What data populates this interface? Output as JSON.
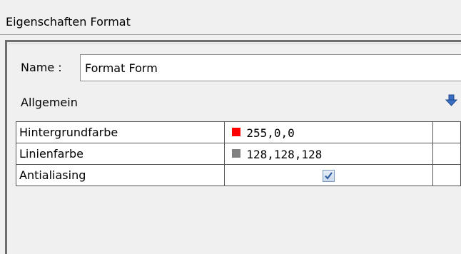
{
  "panel": {
    "title": "Eigenschaften Format"
  },
  "name_field": {
    "label": "Name :",
    "value": "Format Form"
  },
  "section": {
    "label": "Allgemein"
  },
  "properties": [
    {
      "name": "Hintergrundfarbe",
      "value": "255,0,0",
      "swatch_color": "#ff0000"
    },
    {
      "name": "Linienfarbe",
      "value": "128,128,128",
      "swatch_color": "#808080"
    },
    {
      "name": "Antialiasing",
      "checked": true
    }
  ],
  "colors": {
    "background": "#f0f0f0",
    "checkbox_tick": "#2a5a9a",
    "arrow_icon": "#3a6fc4"
  }
}
